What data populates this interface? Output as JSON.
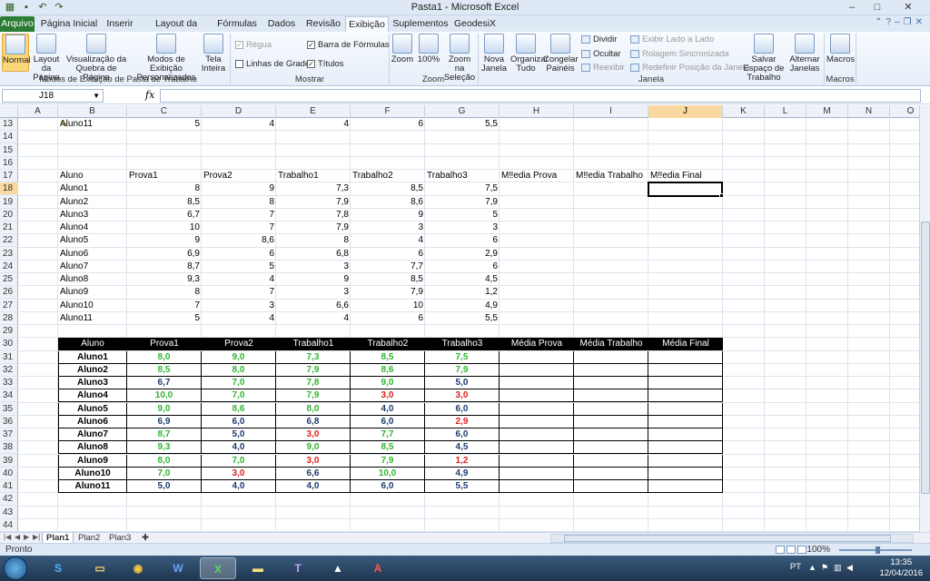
{
  "window": {
    "title": "Pasta1 - Microsoft Excel",
    "controls": [
      "–",
      "□",
      "✕"
    ]
  },
  "tabs": [
    "Arquivo",
    "Página Inicial",
    "Inserir",
    "Layout da Página",
    "Fórmulas",
    "Dados",
    "Revisão",
    "Exibição",
    "Suplementos",
    "GeodesiX"
  ],
  "active_tab": "Exibição",
  "ribbon": {
    "groups": {
      "modos": {
        "label": "Modos de Exibição de Pasta de Trabalho",
        "buttons": [
          "Normal",
          "Layout da Página",
          "Visualização da Quebra de Página",
          "Modos de Exibição Personalizados",
          "Tela Inteira"
        ]
      },
      "mostrar": {
        "label": "Mostrar",
        "checks": [
          {
            "label": "Régua",
            "checked": true,
            "disabled": true
          },
          {
            "label": "Barra de Fórmulas",
            "checked": true,
            "disabled": false
          },
          {
            "label": "Linhas de Grade",
            "checked": false,
            "disabled": false
          },
          {
            "label": "Títulos",
            "checked": true,
            "disabled": false
          }
        ]
      },
      "zoom": {
        "label": "Zoom",
        "buttons": [
          "Zoom",
          "100%",
          "Zoom na Seleção"
        ]
      },
      "janela": {
        "label": "Janela",
        "buttons": [
          "Nova Janela",
          "Organizar Tudo",
          "Congelar Painéis"
        ],
        "small": [
          {
            "label": "Dividir",
            "disabled": false
          },
          {
            "label": "Ocultar",
            "disabled": false
          },
          {
            "label": "Reexibir",
            "disabled": true
          },
          {
            "label": "Exibir Lado a Lado",
            "disabled": true
          },
          {
            "label": "Rolagem Sincronizada",
            "disabled": true
          },
          {
            "label": "Redefinir Posição da Janela",
            "disabled": true
          }
        ],
        "buttons2": [
          "Salvar Espaço de Trabalho",
          "Alternar Janelas"
        ]
      },
      "macros": {
        "label": "Macros",
        "buttons": [
          "Macros"
        ]
      }
    }
  },
  "formula_bar": {
    "name_box": "J18",
    "fx": "fx",
    "formula": ""
  },
  "columns": [
    "A",
    "B",
    "C",
    "D",
    "E",
    "F",
    "G",
    "H",
    "I",
    "J",
    "K",
    "L",
    "M",
    "N",
    "O"
  ],
  "selected_column": "J",
  "rows": [
    "13",
    "14",
    "15",
    "16",
    "17",
    "18",
    "19",
    "20",
    "21",
    "22",
    "23",
    "24",
    "25",
    "26",
    "27",
    "28",
    "29",
    "30",
    "31",
    "32",
    "33",
    "34",
    "35",
    "36",
    "37",
    "38",
    "39",
    "40",
    "41",
    "42",
    "43",
    "44"
  ],
  "selected_row": "18",
  "row13": [
    "Aluno11",
    "5",
    "4",
    "4",
    "6",
    "5,5"
  ],
  "plain_headers": [
    "Aluno",
    "Prova1",
    "Prova2",
    "Trabalho1",
    "Trabalho2",
    "Trabalho3",
    "M‼edia Prova",
    "M‼edia Trabalho",
    "M‼edia Final"
  ],
  "plain_rows": [
    [
      "Aluno1",
      "8",
      "9",
      "7,3",
      "8,5",
      "7,5"
    ],
    [
      "Aluno2",
      "8,5",
      "8",
      "7,9",
      "8,6",
      "7,9"
    ],
    [
      "Aluno3",
      "6,7",
      "7",
      "7,8",
      "9",
      "5"
    ],
    [
      "Aluno4",
      "10",
      "7",
      "7,9",
      "3",
      "3"
    ],
    [
      "Aluno5",
      "9",
      "8,6",
      "8",
      "4",
      "6"
    ],
    [
      "Aluno6",
      "6,9",
      "6",
      "6,8",
      "6",
      "2,9"
    ],
    [
      "Aluno7",
      "8,7",
      "5",
      "3",
      "7,7",
      "6"
    ],
    [
      "Aluno8",
      "9,3",
      "4",
      "9",
      "8,5",
      "4,5"
    ],
    [
      "Aluno9",
      "8",
      "7",
      "3",
      "7,9",
      "1,2"
    ],
    [
      "Aluno10",
      "7",
      "3",
      "6,6",
      "10",
      "4,9"
    ],
    [
      "Aluno11",
      "5",
      "4",
      "4",
      "6",
      "5,5"
    ]
  ],
  "fmt_headers": [
    "Aluno",
    "Prova1",
    "Prova2",
    "Trabalho1",
    "Trabalho2",
    "Trabalho3",
    "Média Prova",
    "Média Trabalho",
    "Média Final"
  ],
  "fmt_rows": [
    [
      "Aluno1",
      "8,0",
      "9,0",
      "7,3",
      "8,5",
      "7,5"
    ],
    [
      "Aluno2",
      "8,5",
      "8,0",
      "7,9",
      "8,6",
      "7,9"
    ],
    [
      "Aluno3",
      "6,7",
      "7,0",
      "7,8",
      "9,0",
      "5,0"
    ],
    [
      "Aluno4",
      "10,0",
      "7,0",
      "7,9",
      "3,0",
      "3,0"
    ],
    [
      "Aluno5",
      "9,0",
      "8,6",
      "8,0",
      "4,0",
      "6,0"
    ],
    [
      "Aluno6",
      "6,9",
      "6,0",
      "6,8",
      "6,0",
      "2,9"
    ],
    [
      "Aluno7",
      "8,7",
      "5,0",
      "3,0",
      "7,7",
      "6,0"
    ],
    [
      "Aluno8",
      "9,3",
      "4,0",
      "9,0",
      "8,5",
      "4,5"
    ],
    [
      "Aluno9",
      "8,0",
      "7,0",
      "3,0",
      "7,9",
      "1,2"
    ],
    [
      "Aluno10",
      "7,0",
      "3,0",
      "6,6",
      "10,0",
      "4,9"
    ],
    [
      "Aluno11",
      "5,0",
      "4,0",
      "4,0",
      "6,0",
      "5,5"
    ]
  ],
  "value_colors": {
    "high": "#2fb52f",
    "low": "#e02020",
    "mid": "#1f3b6e"
  },
  "sheets": [
    "Plan1",
    "Plan2",
    "Plan3"
  ],
  "active_sheet": "Plan1",
  "status": {
    "ready": "Pronto",
    "zoom": "100%"
  },
  "taskbar": {
    "apps": [
      "skype-icon",
      "folder-icon",
      "chrome-icon",
      "word-icon",
      "excel-icon",
      "notes-icon",
      "tex-icon",
      "inkscape-icon",
      "acrobat-icon"
    ],
    "lang": "PT",
    "time": "13:35",
    "date": "12/04/2016"
  }
}
